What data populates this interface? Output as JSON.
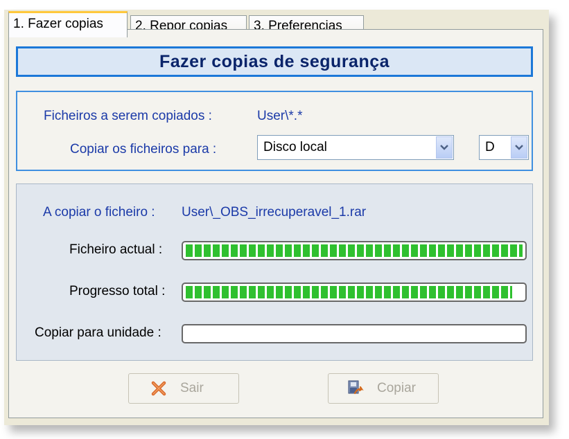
{
  "tabs": [
    {
      "label": "1. Fazer copias"
    },
    {
      "label": "2. Repor copias"
    },
    {
      "label": "3. Preferencias"
    }
  ],
  "header": {
    "title": "Fazer copias de segurança"
  },
  "files": {
    "label": "Ficheiros a serem copiados :",
    "value": "User\\*.*"
  },
  "destination": {
    "label": "Copiar os ficheiros para :",
    "location_value": "Disco local",
    "drive_value": "D"
  },
  "progress": {
    "current_label": "A copiar o ficheiro :",
    "current_file": "User\\_OBS_irrecuperavel_1.rar",
    "file_label": "Ficheiro actual :",
    "file_progress": 1.0,
    "total_label": "Progresso total :",
    "total_progress": 0.97,
    "unit_label": "Copiar para unidade :",
    "unit_progress": 0.0
  },
  "buttons": {
    "exit_label": "Sair",
    "copy_label": "Copiar"
  },
  "colors": {
    "accent": "#1c78d8",
    "label_text": "#1b3aa8",
    "progress_green": "#2fc02f",
    "disabled_text": "#a9a69c"
  },
  "icons": {
    "exit": "close-x-icon",
    "copy": "copy-disk-icon"
  }
}
